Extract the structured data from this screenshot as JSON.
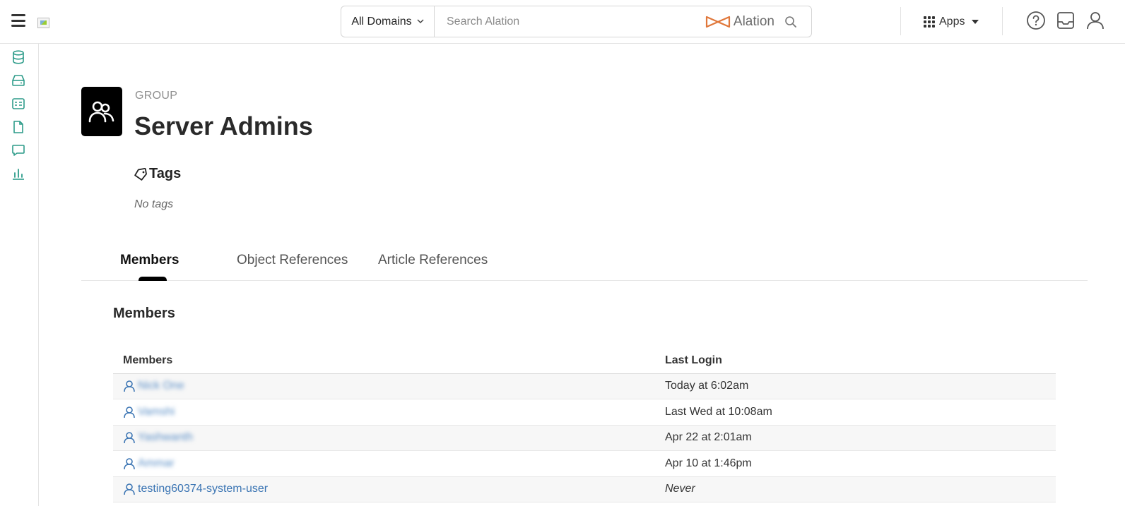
{
  "topbar": {
    "domain_select": "All Domains",
    "search_placeholder": "Search Alation",
    "brand": "Alation",
    "apps_label": "Apps"
  },
  "page": {
    "type_label": "GROUP",
    "title": "Server Admins"
  },
  "tags": {
    "heading": "Tags",
    "empty_text": "No tags"
  },
  "tabs": [
    {
      "label": "Members",
      "active": true
    },
    {
      "label": "Object References",
      "active": false
    },
    {
      "label": "Article References",
      "active": false
    }
  ],
  "members_section": {
    "title": "Members",
    "columns": [
      "Members",
      "Last Login"
    ],
    "rows": [
      {
        "name": "Nick One",
        "last_login": "Today at 6:02am",
        "blurred": true
      },
      {
        "name": "Vamshi",
        "last_login": "Last Wed at 10:08am",
        "blurred": true
      },
      {
        "name": "Yashwanth",
        "last_login": "Apr 22 at 2:01am",
        "blurred": true
      },
      {
        "name": "Ammar",
        "last_login": "Apr 10 at 1:46pm",
        "blurred": true
      },
      {
        "name": "testing60374-system-user",
        "last_login": "Never",
        "blurred": false
      }
    ]
  },
  "colors": {
    "rail_icon": "#2e9c8a",
    "brand_orange": "#e0773a",
    "link_blue": "#3a74b3"
  }
}
